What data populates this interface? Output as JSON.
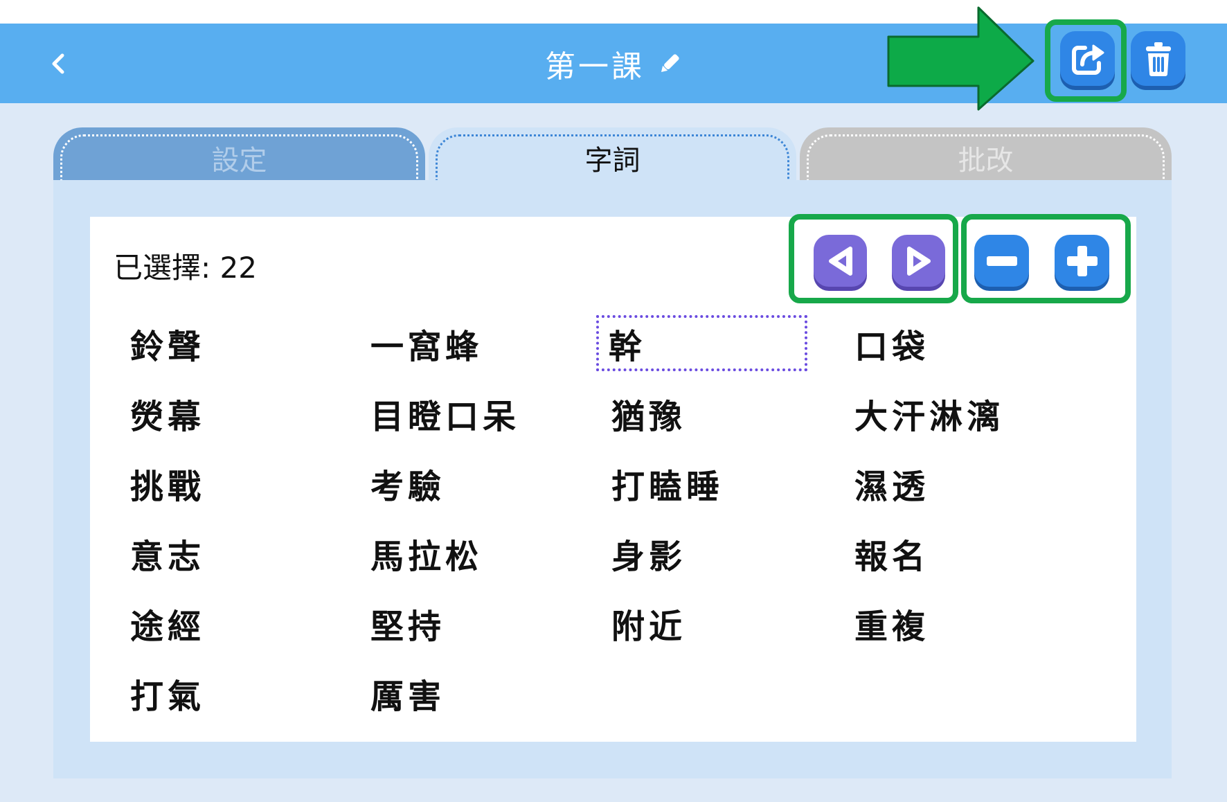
{
  "header": {
    "back_icon": "chevron-left-icon",
    "title": "第一課",
    "edit_icon": "pencil-icon",
    "share_icon": "share-icon",
    "delete_icon": "trash-icon"
  },
  "tabs": [
    {
      "label": "設定",
      "state": "inactive"
    },
    {
      "label": "字詞",
      "state": "active"
    },
    {
      "label": "批改",
      "state": "disabled"
    }
  ],
  "selection": {
    "label": "已選擇: 22"
  },
  "controls": {
    "prev_icon": "triangle-left-icon",
    "next_icon": "triangle-right-icon",
    "zoom_out_icon": "minus-icon",
    "zoom_in_icon": "plus-icon"
  },
  "words": [
    "鈴聲",
    "一窩蜂",
    "幹",
    "口袋",
    "熒幕",
    "目瞪口呆",
    "猶豫",
    "大汗淋漓",
    "挑戰",
    "考驗",
    "打瞌睡",
    "濕透",
    "意志",
    "馬拉松",
    "身影",
    "報名",
    "途經",
    "堅持",
    "附近",
    "重複",
    "打氣",
    "厲害"
  ],
  "selected_word": "幹",
  "annotations": {
    "arrow_icon": "green-arrow-icon",
    "highlight_color": "#17a84a"
  },
  "colors": {
    "header": "#58aef0",
    "background": "#dde9f7",
    "panel": "#cfe3f7",
    "button_blue": "#2f86e6",
    "button_purple": "#7a6ad9",
    "selection_border": "#6a4be0"
  }
}
